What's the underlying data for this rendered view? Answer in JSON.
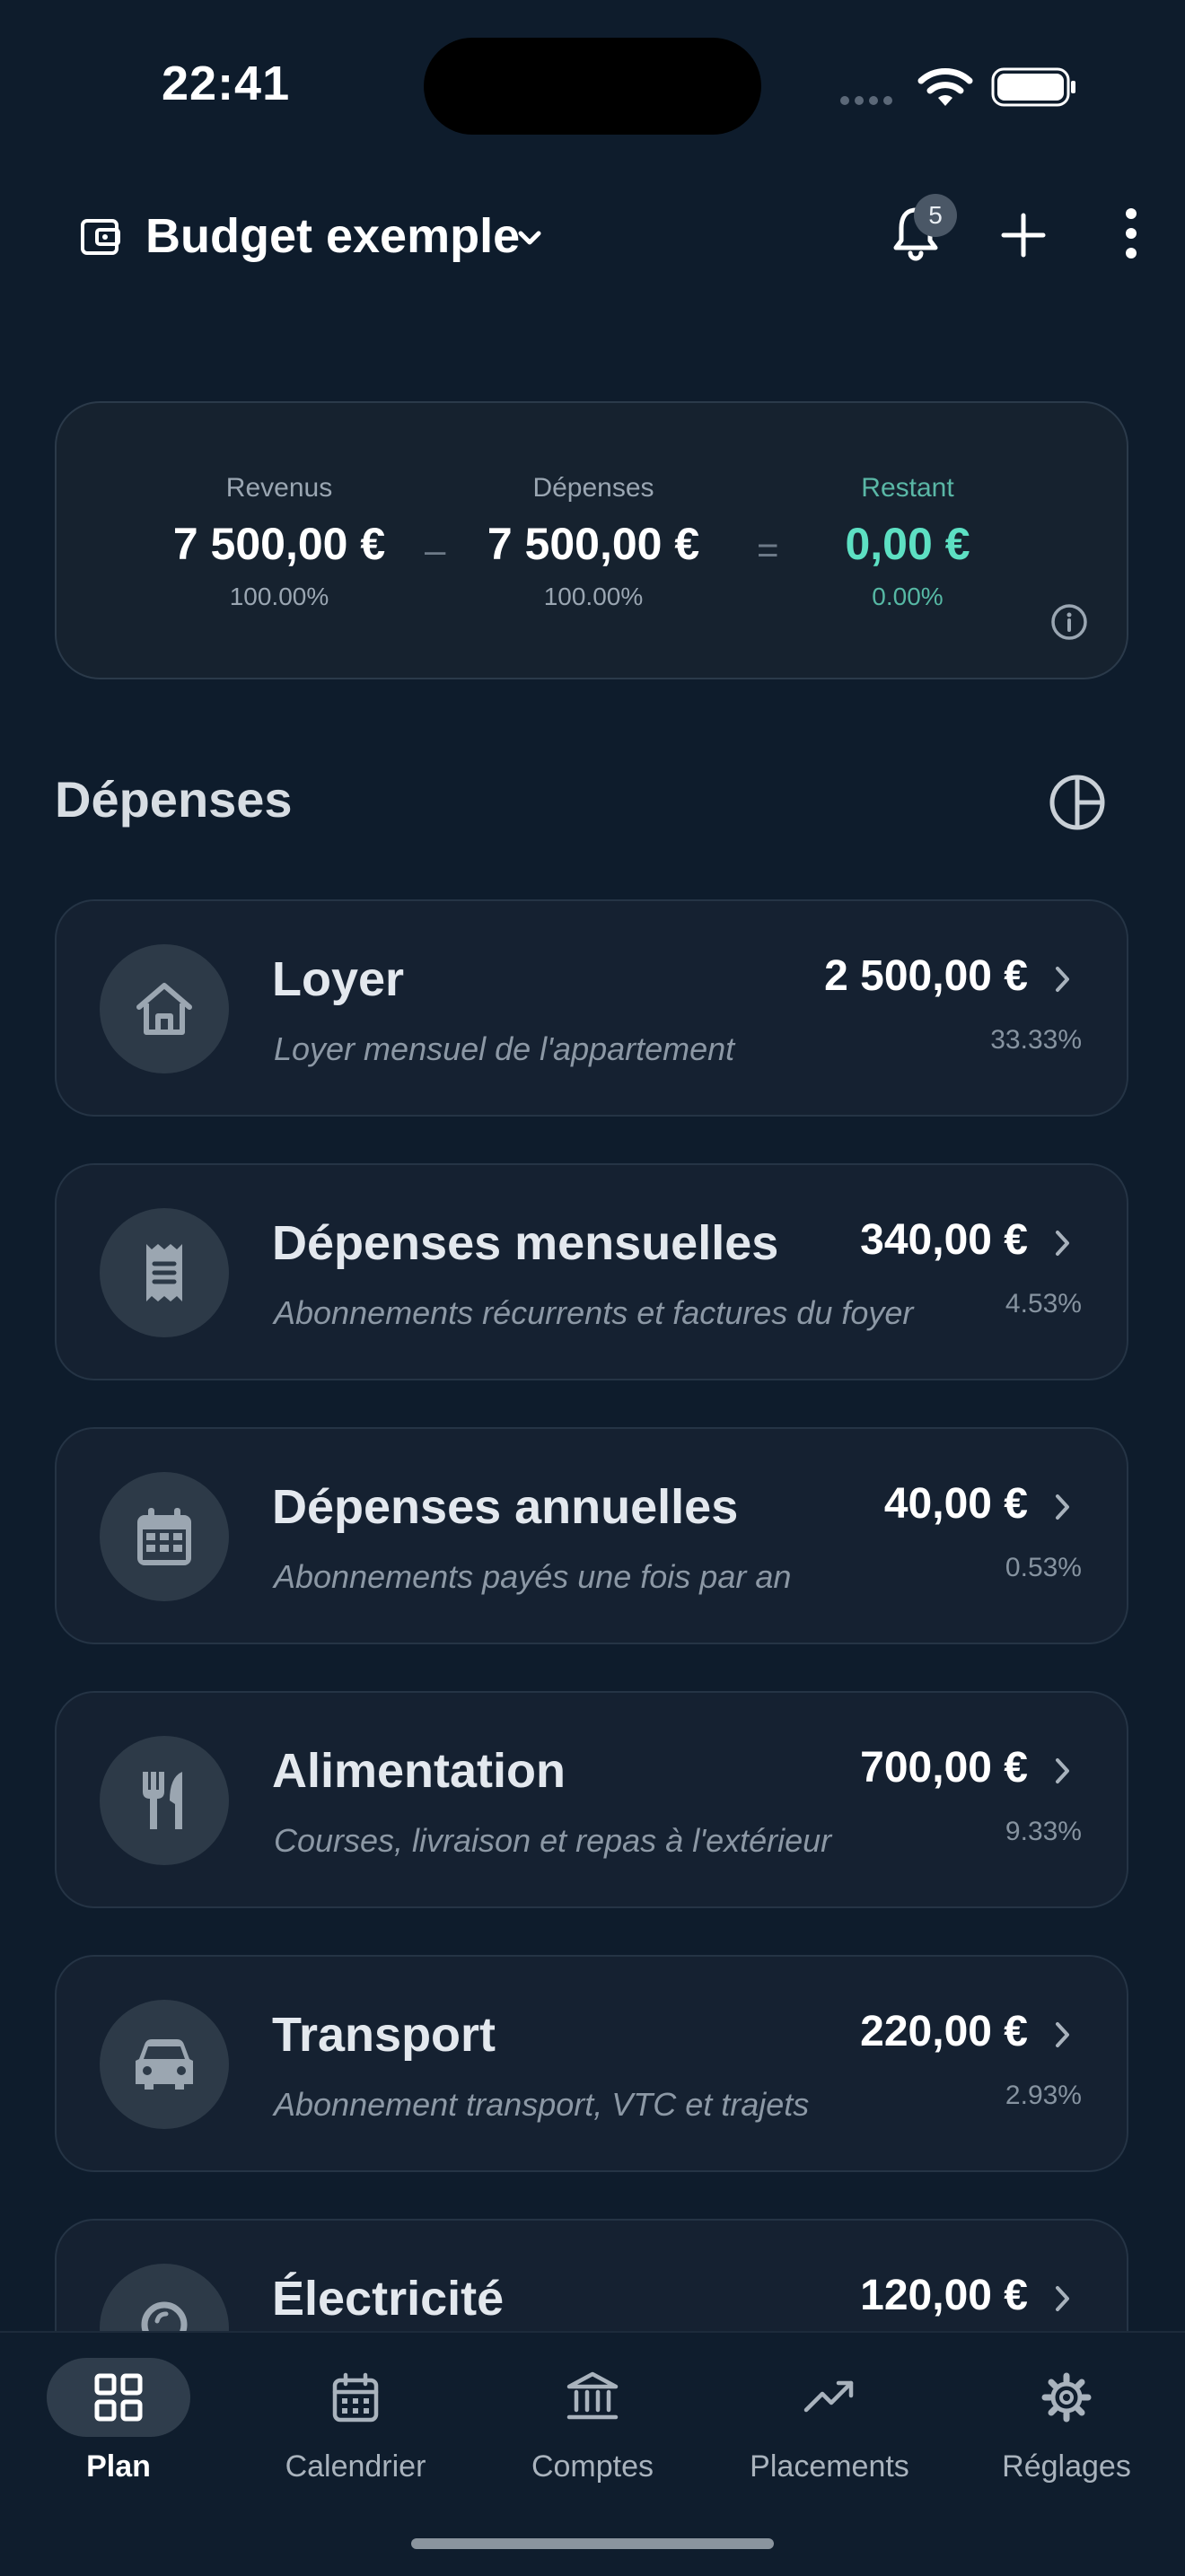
{
  "status_bar": {
    "time": "22:41"
  },
  "header": {
    "title": "Budget exemple",
    "notifications_count": "5",
    "icons": [
      "wallet-icon",
      "chevron-down-icon",
      "bell-icon",
      "plus-icon",
      "more-vertical-icon"
    ]
  },
  "summary": {
    "income": {
      "label": "Revenus",
      "value": "7 500,00 €",
      "percent": "100.00%"
    },
    "minus": "–",
    "expenses": {
      "label": "Dépenses",
      "value": "7 500,00 €",
      "percent": "100.00%"
    },
    "equals": "=",
    "remaining": {
      "label": "Restant",
      "value": "0,00 €",
      "percent": "0.00%"
    },
    "accent_color": "#5de0c3"
  },
  "section": {
    "title": "Dépenses"
  },
  "categories": [
    {
      "name": "Loyer",
      "description": "Loyer mensuel de l'appartement",
      "amount": "2 500,00 €",
      "percent": "33.33%",
      "icon": "home-icon"
    },
    {
      "name": "Dépenses mensuelles",
      "description": "Abonnements récurrents et factures du foyer",
      "amount": "340,00 €",
      "percent": "4.53%",
      "icon": "receipt-icon"
    },
    {
      "name": "Dépenses annuelles",
      "description": "Abonnements payés une fois par an",
      "amount": "40,00 €",
      "percent": "0.53%",
      "icon": "calendar-icon"
    },
    {
      "name": "Alimentation",
      "description": "Courses, livraison et repas à l'extérieur",
      "amount": "700,00 €",
      "percent": "9.33%",
      "icon": "restaurant-icon"
    },
    {
      "name": "Transport",
      "description": "Abonnement transport, VTC et trajets",
      "amount": "220,00 €",
      "percent": "2.93%",
      "icon": "car-icon"
    },
    {
      "name": "Électricité",
      "description": "",
      "amount": "120,00 €",
      "percent": "",
      "icon": "lightbulb-icon"
    }
  ],
  "nav": [
    {
      "label": "Plan",
      "icon": "grid-icon",
      "active": true
    },
    {
      "label": "Calendrier",
      "icon": "calendar-icon",
      "active": false
    },
    {
      "label": "Comptes",
      "icon": "bank-icon",
      "active": false
    },
    {
      "label": "Placements",
      "icon": "trending-up-icon",
      "active": false
    },
    {
      "label": "Réglages",
      "icon": "gear-icon",
      "active": false
    }
  ]
}
